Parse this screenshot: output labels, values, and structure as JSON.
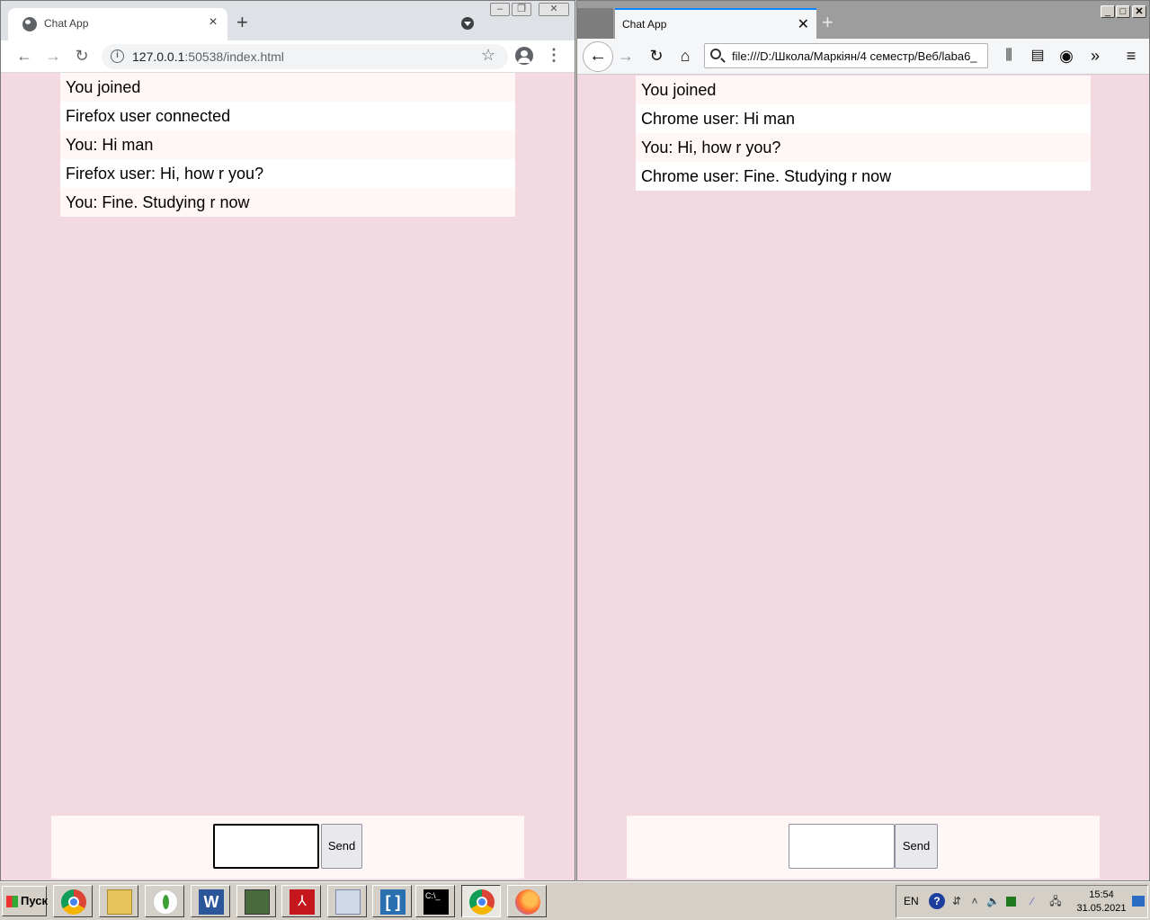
{
  "chrome": {
    "tab_title": "Chat App",
    "url_host": "127.0.0.1",
    "url_rest": ":50538/index.html",
    "messages": [
      "You joined",
      "Firefox user connected",
      "You: Hi man",
      "Firefox user: Hi, how r you?",
      "You: Fine. Studying r now"
    ],
    "send_label": "Send"
  },
  "firefox": {
    "tab_title": "Chat App",
    "url": "file:///D:/Школа/Маркіян/4 семестр/Веб/laba6_",
    "messages": [
      "You joined",
      "Chrome user: Hi man",
      "You: Hi, how r you?",
      "Chrome user: Fine. Studying r now"
    ],
    "send_label": "Send"
  },
  "taskbar": {
    "start_label": "Пуск",
    "apps": [
      "chrome-icon",
      "file-manager-icon",
      "mongodb-icon",
      "word-icon",
      "system-monitor-icon",
      "acrobat-icon",
      "calculator-icon",
      "brackets-icon",
      "terminal-icon",
      "chrome-icon",
      "firefox-icon"
    ],
    "lang": "EN",
    "help": "?",
    "time": "15:54",
    "date": "31.05.2021"
  },
  "colors": {
    "page_bg": "#f2d9e2",
    "msg_odd": "#fff6f6",
    "msg_even": "#ffffff",
    "form_bg": "#fff6f6"
  }
}
